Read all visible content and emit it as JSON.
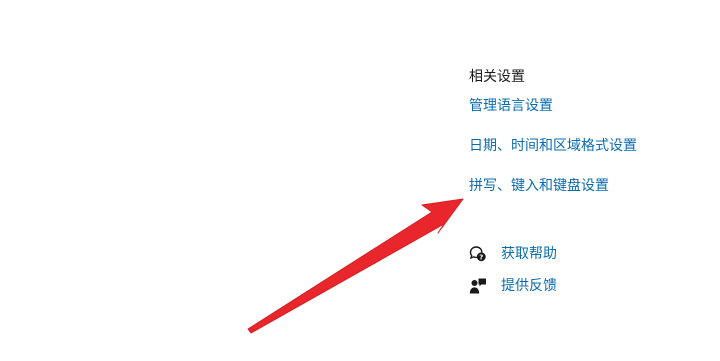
{
  "related_settings": {
    "heading": "相关设置",
    "links": [
      "管理语言设置",
      "日期、时间和区域格式设置",
      "拼写、键入和键盘设置"
    ]
  },
  "help": {
    "get_help": {
      "label": "获取帮助",
      "icon": "chat-help-icon"
    },
    "feedback": {
      "label": "提供反馈",
      "icon": "feedback-icon"
    }
  },
  "annotation": {
    "icon": "red-arrow-icon",
    "color": "#e8262b"
  },
  "colors": {
    "link": "#0a6cae",
    "text": "#1a1a1a"
  }
}
